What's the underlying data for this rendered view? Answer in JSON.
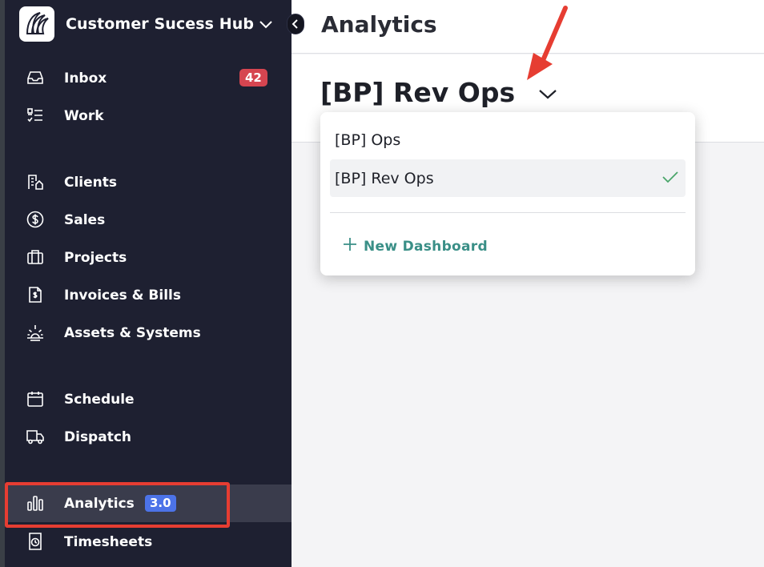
{
  "sidebar": {
    "org_name": "Customer Sucess Hub",
    "items": [
      {
        "label": "Inbox",
        "icon": "inbox-icon",
        "badge": "42"
      },
      {
        "label": "Work",
        "icon": "checklist-icon"
      },
      {
        "label": "Clients",
        "icon": "buildings-icon"
      },
      {
        "label": "Sales",
        "icon": "dollar-circle-icon"
      },
      {
        "label": "Projects",
        "icon": "briefcase-icon"
      },
      {
        "label": "Invoices & Bills",
        "icon": "invoice-icon"
      },
      {
        "label": "Assets & Systems",
        "icon": "sunrise-icon"
      },
      {
        "label": "Schedule",
        "icon": "calendar-icon"
      },
      {
        "label": "Dispatch",
        "icon": "truck-icon"
      },
      {
        "label": "Analytics",
        "icon": "bar-chart-icon",
        "badge": "3.0",
        "active": true
      },
      {
        "label": "Timesheets",
        "icon": "clock-sheet-icon"
      }
    ]
  },
  "main": {
    "page_title": "Analytics",
    "dashboard_title": "[BP] Rev Ops"
  },
  "dropdown": {
    "options": [
      {
        "label": "[BP] Ops",
        "selected": false
      },
      {
        "label": "[BP] Rev Ops",
        "selected": true
      }
    ],
    "new_label": "New Dashboard"
  },
  "colors": {
    "sidebar_bg": "#1e2031",
    "inbox_badge": "#d64550",
    "version_badge": "#4c73e8",
    "accent_teal": "#3a8f87",
    "annotation_red": "#e63d32"
  }
}
